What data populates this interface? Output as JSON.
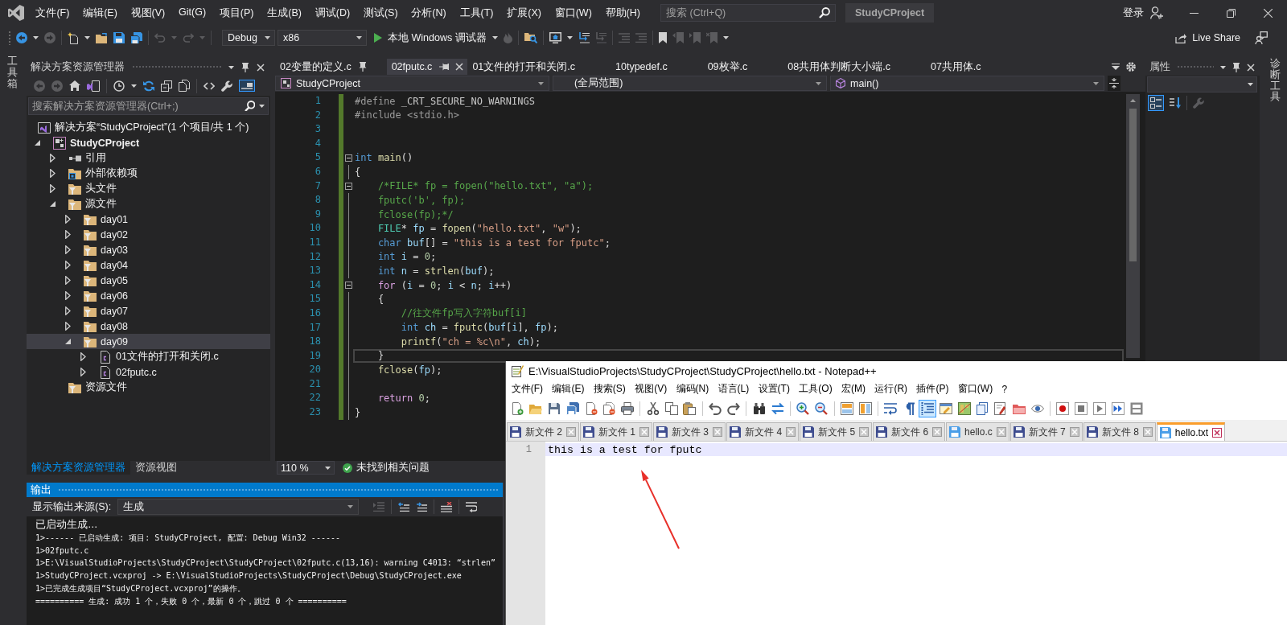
{
  "window": {
    "title": "StudyCProject",
    "search": {
      "placeholder": "搜索 (Ctrl+Q)"
    },
    "sign_in": "登录"
  },
  "menu": [
    "文件(F)",
    "编辑(E)",
    "视图(V)",
    "Git(G)",
    "项目(P)",
    "生成(B)",
    "调试(D)",
    "测试(S)",
    "分析(N)",
    "工具(T)",
    "扩展(X)",
    "窗口(W)",
    "帮助(H)"
  ],
  "toolbar": {
    "left": [
      {
        "kind": "back",
        "disabled": false
      },
      {
        "kind": "caret",
        "disabled": false
      },
      {
        "kind": "forward",
        "disabled": true
      },
      {
        "kind": "separator"
      },
      {
        "kind": "new-item",
        "disabled": false
      },
      {
        "kind": "caret",
        "disabled": false
      },
      {
        "kind": "open",
        "disabled": false
      },
      {
        "kind": "save",
        "disabled": false
      },
      {
        "kind": "save-all",
        "disabled": false
      },
      {
        "kind": "separator"
      },
      {
        "kind": "undo",
        "disabled": true
      },
      {
        "kind": "caret",
        "disabled": true
      },
      {
        "kind": "redo",
        "disabled": true
      },
      {
        "kind": "caret",
        "disabled": true
      },
      {
        "kind": "separator"
      }
    ],
    "configuration": "Debug",
    "platform": "x86",
    "run": "本地 Windows 调试器",
    "right": [
      {
        "kind": "caret",
        "disabled": false
      },
      {
        "kind": "flame",
        "disabled": true
      },
      {
        "kind": "separator"
      },
      {
        "kind": "find-in-files",
        "disabled": false
      },
      {
        "kind": "separator"
      },
      {
        "kind": "browser",
        "disabled": false
      },
      {
        "kind": "caret",
        "disabled": false
      },
      {
        "kind": "step",
        "disabled": false
      },
      {
        "kind": "step",
        "disabled": true
      },
      {
        "kind": "separator"
      },
      {
        "kind": "comment",
        "disabled": true
      },
      {
        "kind": "comment",
        "disabled": true
      },
      {
        "kind": "separator"
      },
      {
        "kind": "bookmark",
        "disabled": false
      },
      {
        "kind": "bookmark-prev",
        "disabled": true
      },
      {
        "kind": "bookmark-next",
        "disabled": true
      },
      {
        "kind": "bookmark-clear",
        "disabled": true
      },
      {
        "kind": "caret",
        "disabled": false
      }
    ],
    "live_share": "Live Share"
  },
  "toolbox_strip": {
    "label": "工具箱"
  },
  "solution_explorer": {
    "title": "解决方案资源管理器",
    "toolbar": [
      {
        "kind": "back",
        "disabled": true,
        "on": false
      },
      {
        "kind": "forward",
        "disabled": true,
        "on": false
      },
      {
        "kind": "home",
        "disabled": false,
        "on": false
      },
      {
        "kind": "switch-views",
        "disabled": false,
        "on": false
      },
      {
        "kind": "separator"
      },
      {
        "kind": "history",
        "disabled": false,
        "on": false
      },
      {
        "kind": "caret",
        "disabled": false,
        "on": false
      },
      {
        "kind": "sync",
        "disabled": false,
        "on": false
      },
      {
        "kind": "collapse",
        "disabled": false,
        "on": false
      },
      {
        "kind": "show-all",
        "disabled": false,
        "on": false
      },
      {
        "kind": "separator"
      },
      {
        "kind": "code",
        "disabled": false,
        "on": false
      },
      {
        "kind": "wrench",
        "disabled": false,
        "on": false
      },
      {
        "kind": "preview",
        "disabled": false,
        "on": true
      }
    ],
    "search": {
      "placeholder": "搜索解决方案资源管理器(Ctrl+;)"
    },
    "tree": [
      {
        "kind": "solution",
        "label": "解决方案“StudyCProject”(1 个项目/共 1 个)",
        "selected": false,
        "children": [
          {
            "kind": "project",
            "label": "StudyCProject",
            "expanded": true,
            "selected": false,
            "children": [
              {
                "kind": "references",
                "label": "引用",
                "expanded": false,
                "selected": false
              },
              {
                "kind": "external",
                "label": "外部依赖项",
                "expanded": false,
                "selected": false
              },
              {
                "kind": "filter",
                "label": "头文件",
                "expanded": false,
                "selected": false
              },
              {
                "kind": "filter",
                "label": "源文件",
                "expanded": true,
                "selected": false,
                "children": [
                  {
                    "kind": "filter",
                    "label": "day01",
                    "expanded": false,
                    "selected": false
                  },
                  {
                    "kind": "filter",
                    "label": "day02",
                    "expanded": false,
                    "selected": false
                  },
                  {
                    "kind": "filter",
                    "label": "day03",
                    "expanded": false,
                    "selected": false
                  },
                  {
                    "kind": "filter",
                    "label": "day04",
                    "expanded": false,
                    "selected": false
                  },
                  {
                    "kind": "filter",
                    "label": "day05",
                    "expanded": false,
                    "selected": false
                  },
                  {
                    "kind": "filter",
                    "label": "day06",
                    "expanded": false,
                    "selected": false
                  },
                  {
                    "kind": "filter",
                    "label": "day07",
                    "expanded": false,
                    "selected": false
                  },
                  {
                    "kind": "filter",
                    "label": "day08",
                    "expanded": false,
                    "selected": false
                  },
                  {
                    "kind": "filter",
                    "label": "day09",
                    "expanded": true,
                    "selected": true,
                    "children": [
                      {
                        "kind": "c-file",
                        "label": "01文件的打开和关闭.c",
                        "expanded": false,
                        "selected": false
                      },
                      {
                        "kind": "c-file",
                        "label": "02fputc.c",
                        "expanded": false,
                        "selected": false
                      }
                    ]
                  }
                ]
              },
              {
                "kind": "filter",
                "label": "资源文件",
                "selected": false
              }
            ]
          }
        ]
      }
    ],
    "tabs": [
      {
        "label": "解决方案资源管理器",
        "selected": true
      },
      {
        "label": "资源视图",
        "selected": false
      }
    ]
  },
  "editor": {
    "tabs": [
      {
        "label": "02变量的定义.c",
        "selected": false,
        "pinned": true
      },
      {
        "label": "02fputc.c",
        "selected": true,
        "pinned": false
      },
      {
        "label": "01文件的打开和关闭.c",
        "selected": false,
        "pinned": false
      },
      {
        "label": "10typedef.c",
        "selected": false,
        "pinned": false
      },
      {
        "label": "09枚举.c",
        "selected": false,
        "pinned": false
      },
      {
        "label": "08共用体判断大小端.c",
        "selected": false,
        "pinned": false
      },
      {
        "label": "07共用体.c",
        "selected": false,
        "pinned": false
      }
    ],
    "nav": {
      "project": "StudyCProject",
      "scope": "(全局范围)",
      "member": "main()"
    },
    "lines": [
      {
        "number": "1",
        "changed": true,
        "fold_start": false,
        "current": false,
        "tokens": [
          {
            "kind": "pp",
            "text": "#define"
          },
          {
            "kind": "macro",
            "text": " _CRT_SECURE_NO_WARNINGS"
          }
        ]
      },
      {
        "number": "2",
        "changed": true,
        "fold_start": false,
        "current": false,
        "tokens": [
          {
            "kind": "pp",
            "text": "#include <stdio.h>"
          }
        ]
      },
      {
        "number": "3",
        "changed": true,
        "fold_start": false,
        "current": false
      },
      {
        "number": "4",
        "changed": true,
        "fold_start": false,
        "current": false
      },
      {
        "number": "5",
        "changed": true,
        "fold_start": true,
        "current": false,
        "tokens": [
          {
            "kind": "kw",
            "text": "int"
          },
          {
            "kind": "fn",
            "text": " main"
          },
          {
            "kind": "p",
            "text": "()"
          }
        ]
      },
      {
        "number": "6",
        "changed": true,
        "fold_start": false,
        "current": false,
        "tokens": [
          {
            "kind": "p",
            "text": "{"
          }
        ]
      },
      {
        "number": "7",
        "changed": true,
        "fold_start": true,
        "current": false,
        "tokens": [
          {
            "kind": "cmt",
            "text": "    /*FILE* fp = fopen(\"hello.txt\", \"a\");"
          }
        ]
      },
      {
        "number": "8",
        "changed": true,
        "fold_start": false,
        "current": false,
        "tokens": [
          {
            "kind": "cmt",
            "text": "    fputc('b', fp);"
          }
        ]
      },
      {
        "number": "9",
        "changed": true,
        "fold_start": false,
        "current": false,
        "tokens": [
          {
            "kind": "cmt",
            "text": "    fclose(fp);*/"
          }
        ]
      },
      {
        "number": "10",
        "changed": true,
        "fold_start": false,
        "current": false,
        "tokens": [
          {
            "kind": "type",
            "text": "    FILE"
          },
          {
            "kind": "p",
            "text": "* "
          },
          {
            "kind": "var",
            "text": "fp"
          },
          {
            "kind": "p",
            "text": " = "
          },
          {
            "kind": "fn",
            "text": "fopen"
          },
          {
            "kind": "p",
            "text": "("
          },
          {
            "kind": "str",
            "text": "\"hello.txt\""
          },
          {
            "kind": "p",
            "text": ", "
          },
          {
            "kind": "str",
            "text": "\"w\""
          },
          {
            "kind": "p",
            "text": ");"
          }
        ]
      },
      {
        "number": "11",
        "changed": true,
        "fold_start": false,
        "current": false,
        "tokens": [
          {
            "kind": "kw",
            "text": "    char"
          },
          {
            "kind": "var",
            "text": " buf"
          },
          {
            "kind": "p",
            "text": "[] = "
          },
          {
            "kind": "str",
            "text": "\"this is a test for fputc\""
          },
          {
            "kind": "p",
            "text": ";"
          }
        ]
      },
      {
        "number": "12",
        "changed": true,
        "fold_start": false,
        "current": false,
        "tokens": [
          {
            "kind": "kw",
            "text": "    int"
          },
          {
            "kind": "var",
            "text": " i"
          },
          {
            "kind": "p",
            "text": " = "
          },
          {
            "kind": "num",
            "text": "0"
          },
          {
            "kind": "p",
            "text": ";"
          }
        ]
      },
      {
        "number": "13",
        "changed": true,
        "fold_start": false,
        "current": false,
        "tokens": [
          {
            "kind": "kw",
            "text": "    int"
          },
          {
            "kind": "var",
            "text": " n"
          },
          {
            "kind": "p",
            "text": " = "
          },
          {
            "kind": "fn",
            "text": "strlen"
          },
          {
            "kind": "p",
            "text": "("
          },
          {
            "kind": "var",
            "text": "buf"
          },
          {
            "kind": "p",
            "text": ");"
          }
        ]
      },
      {
        "number": "14",
        "changed": true,
        "fold_start": true,
        "current": false,
        "tokens": [
          {
            "kind": "ctl",
            "text": "    for"
          },
          {
            "kind": "p",
            "text": " ("
          },
          {
            "kind": "var",
            "text": "i"
          },
          {
            "kind": "p",
            "text": " = "
          },
          {
            "kind": "num",
            "text": "0"
          },
          {
            "kind": "p",
            "text": "; "
          },
          {
            "kind": "var",
            "text": "i"
          },
          {
            "kind": "p",
            "text": " < "
          },
          {
            "kind": "var",
            "text": "n"
          },
          {
            "kind": "p",
            "text": "; "
          },
          {
            "kind": "var",
            "text": "i"
          },
          {
            "kind": "p",
            "text": "++)"
          }
        ]
      },
      {
        "number": "15",
        "changed": true,
        "fold_start": false,
        "current": false,
        "tokens": [
          {
            "kind": "p",
            "text": "    {"
          }
        ]
      },
      {
        "number": "16",
        "changed": true,
        "fold_start": false,
        "current": false,
        "tokens": [
          {
            "kind": "cmt",
            "text": "        //往文件fp写入字符buf[i]"
          }
        ]
      },
      {
        "number": "17",
        "changed": true,
        "fold_start": false,
        "current": false,
        "tokens": [
          {
            "kind": "kw",
            "text": "        int"
          },
          {
            "kind": "var",
            "text": " ch"
          },
          {
            "kind": "p",
            "text": " = "
          },
          {
            "kind": "fn",
            "text": "fputc"
          },
          {
            "kind": "p",
            "text": "("
          },
          {
            "kind": "var",
            "text": "buf"
          },
          {
            "kind": "p",
            "text": "["
          },
          {
            "kind": "var",
            "text": "i"
          },
          {
            "kind": "p",
            "text": "], "
          },
          {
            "kind": "var",
            "text": "fp"
          },
          {
            "kind": "p",
            "text": ");"
          }
        ]
      },
      {
        "number": "18",
        "changed": true,
        "fold_start": false,
        "current": false,
        "tokens": [
          {
            "kind": "fn",
            "text": "        printf"
          },
          {
            "kind": "p",
            "text": "("
          },
          {
            "kind": "str",
            "text": "\"ch = %c\\n\""
          },
          {
            "kind": "p",
            "text": ", "
          },
          {
            "kind": "var",
            "text": "ch"
          },
          {
            "kind": "p",
            "text": ");"
          }
        ]
      },
      {
        "number": "19",
        "changed": true,
        "fold_start": false,
        "current": true,
        "tokens": [
          {
            "kind": "p",
            "text": "    }"
          }
        ]
      },
      {
        "number": "20",
        "changed": true,
        "fold_start": false,
        "current": false,
        "tokens": [
          {
            "kind": "fn",
            "text": "    fclose"
          },
          {
            "kind": "p",
            "text": "("
          },
          {
            "kind": "var",
            "text": "fp"
          },
          {
            "kind": "p",
            "text": ");"
          }
        ]
      },
      {
        "number": "21",
        "changed": true,
        "fold_start": false,
        "current": false
      },
      {
        "number": "22",
        "changed": true,
        "fold_start": false,
        "current": false,
        "tokens": [
          {
            "kind": "ctl",
            "text": "    return"
          },
          {
            "kind": "num",
            "text": " 0"
          },
          {
            "kind": "p",
            "text": ";"
          }
        ]
      },
      {
        "number": "23",
        "changed": true,
        "fold_start": false,
        "current": false,
        "tokens": [
          {
            "kind": "p",
            "text": "}"
          }
        ]
      }
    ],
    "zoom": "110 %",
    "issues": "未找到相关问题"
  },
  "properties": {
    "title": "属性",
    "toolbar": [
      {
        "kind": "categorized",
        "disabled": false,
        "on": true
      },
      {
        "kind": "alphabetical",
        "disabled": false,
        "on": false
      },
      {
        "kind": "separator"
      },
      {
        "kind": "wrench",
        "disabled": true,
        "on": false
      }
    ]
  },
  "diagnostics_strip": {
    "label": "诊断工具"
  },
  "output": {
    "title": "输出",
    "source_label": "显示输出来源(S):",
    "source": "生成",
    "toolbar": [
      {
        "kind": "goto-message",
        "disabled": true
      },
      {
        "kind": "separator"
      },
      {
        "kind": "prev-message",
        "disabled": false
      },
      {
        "kind": "next-message",
        "disabled": false
      },
      {
        "kind": "separator"
      },
      {
        "kind": "clear",
        "disabled": false
      },
      {
        "kind": "separator"
      },
      {
        "kind": "word-wrap",
        "disabled": false
      }
    ],
    "lines": [
      {
        "kind": "status",
        "text": "已启动生成…"
      },
      {
        "kind": "log",
        "text": "1>------ 已启动生成: 项目: StudyCProject, 配置: Debug Win32 ------"
      },
      {
        "kind": "log",
        "text": "1>02fputc.c"
      },
      {
        "kind": "log",
        "text": "1>E:\\VisualStudioProjects\\StudyCProject\\StudyCProject\\02fputc.c(13,16): warning C4013: “strlen”"
      },
      {
        "kind": "log",
        "text": "1>StudyCProject.vcxproj -> E:\\VisualStudioProjects\\StudyCProject\\Debug\\StudyCProject.exe"
      },
      {
        "kind": "log",
        "text": "1>已完成生成项目“StudyCProject.vcxproj”的操作。"
      },
      {
        "kind": "log",
        "text": "========== 生成: 成功 1 个，失败 0 个，最新 0 个，跳过 0 个 =========="
      }
    ]
  },
  "notepad": {
    "title": "E:\\VisualStudioProjects\\StudyCProject\\StudyCProject\\hello.txt - Notepad++",
    "menu": [
      "文件(F)",
      "编辑(E)",
      "搜索(S)",
      "视图(V)",
      "编码(N)",
      "语言(L)",
      "设置(T)",
      "工具(O)",
      "宏(M)",
      "运行(R)",
      "插件(P)",
      "窗口(W)",
      "?"
    ],
    "toolbar": [
      {
        "kind": "new",
        "on": false
      },
      {
        "kind": "open",
        "on": false
      },
      {
        "kind": "save",
        "on": false
      },
      {
        "kind": "save-all",
        "on": false
      },
      {
        "kind": "close",
        "on": false
      },
      {
        "kind": "close-all",
        "on": false
      },
      {
        "kind": "print",
        "on": false
      },
      {
        "kind": "separator"
      },
      {
        "kind": "cut",
        "on": false
      },
      {
        "kind": "copy",
        "on": false
      },
      {
        "kind": "paste",
        "on": false
      },
      {
        "kind": "separator"
      },
      {
        "kind": "undo",
        "on": false
      },
      {
        "kind": "redo",
        "on": false
      },
      {
        "kind": "separator"
      },
      {
        "kind": "find",
        "on": false
      },
      {
        "kind": "replace",
        "on": false
      },
      {
        "kind": "separator"
      },
      {
        "kind": "zoom-in",
        "on": false
      },
      {
        "kind": "zoom-out",
        "on": false
      },
      {
        "kind": "separator"
      },
      {
        "kind": "sync-v",
        "on": false
      },
      {
        "kind": "sync-h",
        "on": false
      },
      {
        "kind": "separator"
      },
      {
        "kind": "wrap",
        "on": false
      },
      {
        "kind": "all-chars",
        "on": false
      },
      {
        "kind": "indent-guide",
        "on": true
      },
      {
        "kind": "udl",
        "on": false
      },
      {
        "kind": "doc-map",
        "on": false
      },
      {
        "kind": "doc-list",
        "on": false
      },
      {
        "kind": "func-list",
        "on": false
      },
      {
        "kind": "workspace",
        "on": false
      },
      {
        "kind": "monitor",
        "on": false
      },
      {
        "kind": "separator"
      },
      {
        "kind": "record",
        "on": false
      },
      {
        "kind": "stop",
        "on": false
      },
      {
        "kind": "play",
        "on": false
      },
      {
        "kind": "play-multi",
        "on": false
      },
      {
        "kind": "save-macro",
        "on": false
      }
    ],
    "tabs": [
      {
        "label": "新文件 2",
        "selected": false,
        "saved": false
      },
      {
        "label": "新文件 1",
        "selected": false,
        "saved": false
      },
      {
        "label": "新文件 3",
        "selected": false,
        "saved": false
      },
      {
        "label": "新文件 4",
        "selected": false,
        "saved": false
      },
      {
        "label": "新文件 5",
        "selected": false,
        "saved": false
      },
      {
        "label": "新文件 6",
        "selected": false,
        "saved": false
      },
      {
        "label": "hello.c",
        "selected": false,
        "saved": true
      },
      {
        "label": "新文件 7",
        "selected": false,
        "saved": false
      },
      {
        "label": "新文件 8",
        "selected": false,
        "saved": false
      },
      {
        "label": "hello.txt",
        "selected": true,
        "saved": true
      }
    ],
    "lines": [
      {
        "number": "1",
        "text": "this is a test for fputc",
        "current": true
      }
    ]
  }
}
